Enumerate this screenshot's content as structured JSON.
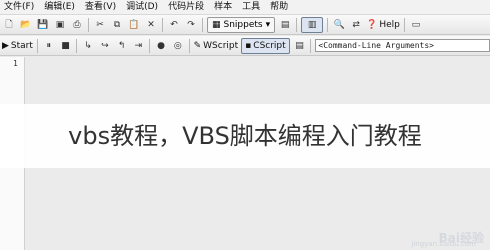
{
  "menu": [
    "文件(F)",
    "编辑(E)",
    "查看(V)",
    "调试(D)",
    "代码片段",
    "样本",
    "工具",
    "帮助"
  ],
  "toolbar1": {
    "snippets_label": "Snippets",
    "help_label": "Help"
  },
  "toolbar2": {
    "start_label": "Start",
    "wscript_label": "WScript",
    "cscript_label": "CScript",
    "args_value": "<Command-Line Arguments>"
  },
  "editor": {
    "line_number": "1"
  },
  "caption": "vbs教程，VBS脚本编程入门教程",
  "watermark": {
    "brand": "Bai经验",
    "sub": "jingyan.baidu.com"
  },
  "colors": {
    "toolbar": "#ececec",
    "editor_bg": "#ebebeb",
    "caption_text": "#333333"
  }
}
